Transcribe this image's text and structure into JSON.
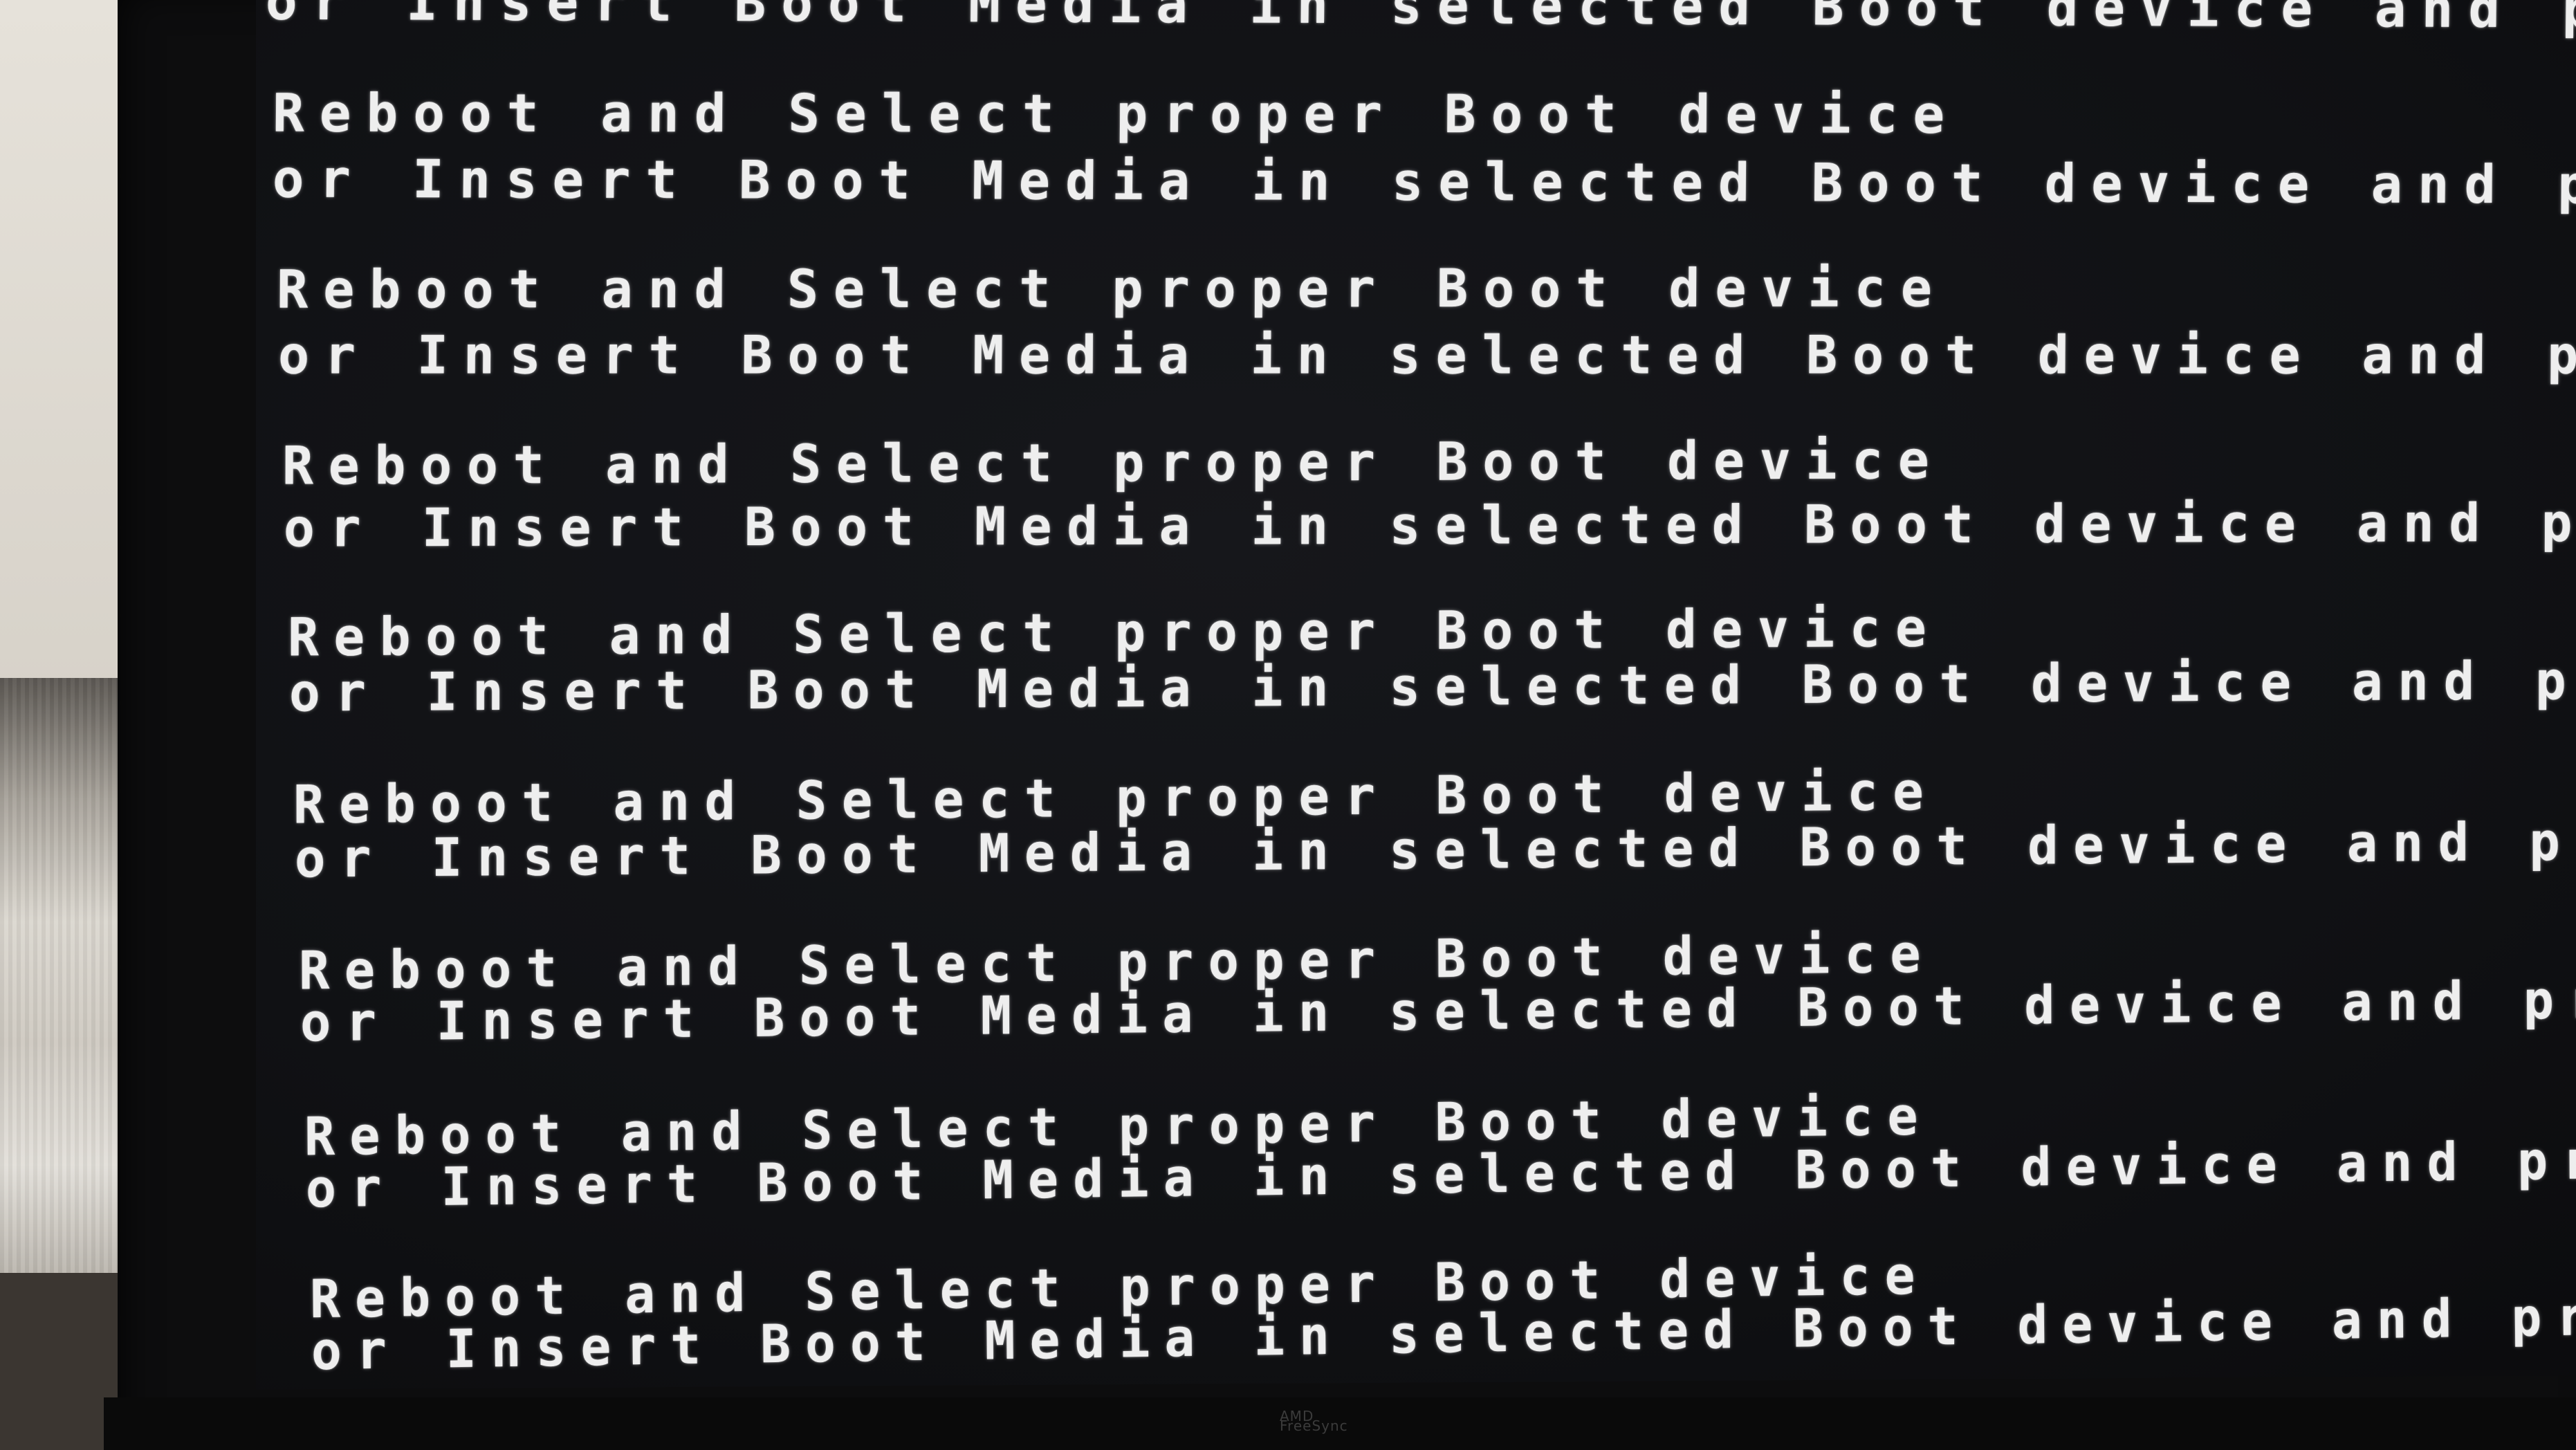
{
  "terminal": {
    "lines": [
      "or Insert Boot Media in selected Boot device and press a key",
      "Reboot and Select proper Boot device",
      "or Insert Boot Media in selected Boot device and press a key",
      "Reboot and Select proper Boot device",
      "or Insert Boot Media in selected Boot device and press a key",
      "Reboot and Select proper Boot device",
      "or Insert Boot Media in selected Boot device and press a key",
      "Reboot and Select proper Boot device",
      "or Insert Boot Media in selected Boot device and press a key",
      "Reboot and Select proper Boot device",
      "or Insert Boot Media in selected Boot device and press a key",
      "Reboot and Select proper Boot device",
      "or Insert Boot Media in selected Boot device and press a key",
      "Reboot and Select proper Boot device",
      "or Insert Boot Media in selected Boot device and press a key",
      "Reboot and Select proper Boot device",
      "or Insert Boot Media in selected Boot device and press a key"
    ],
    "cursor_visible": true,
    "text_color": "#eeeeee",
    "background_color": "#101114"
  },
  "monitor": {
    "brand_text": [
      "AMD",
      "FreeSync"
    ]
  }
}
